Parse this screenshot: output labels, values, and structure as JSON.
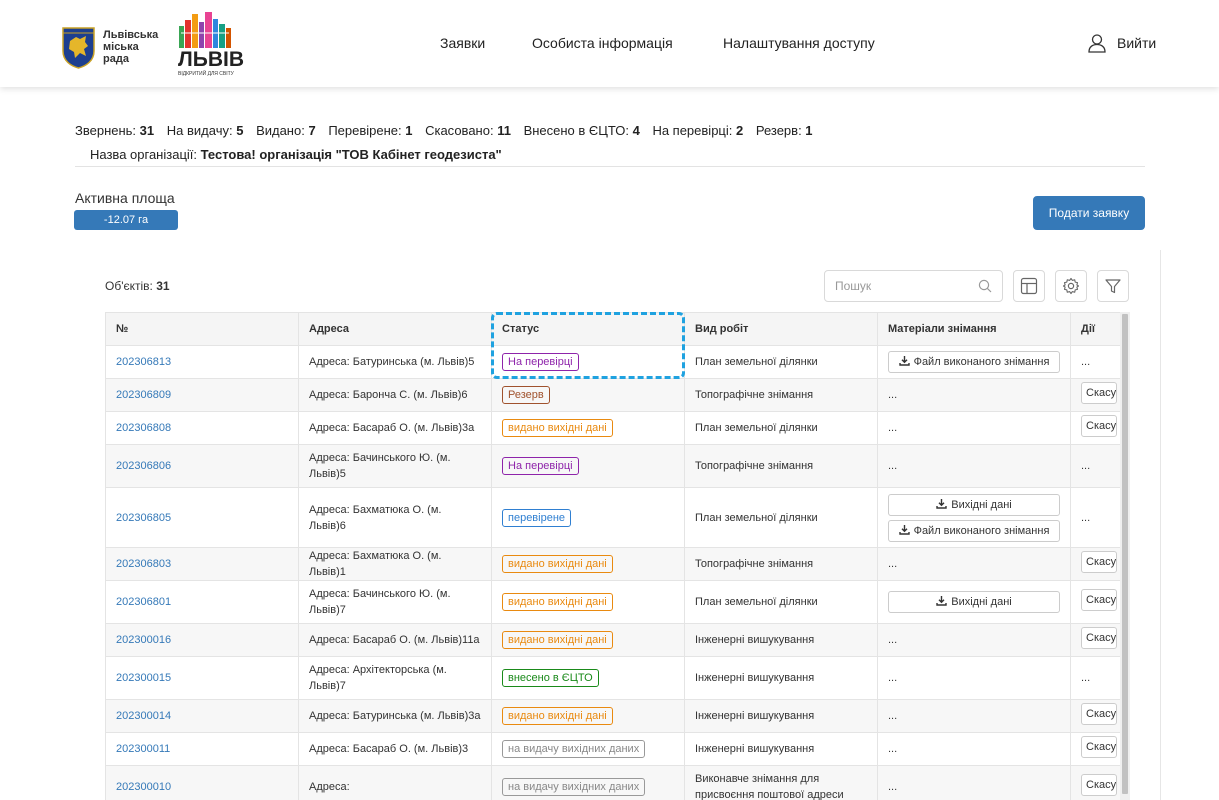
{
  "header": {
    "city_line1": "Львівська",
    "city_line2": "міська",
    "city_line3": "рада",
    "logo_word": "ЛЬВІВ",
    "logo_sub": "ВІДКРИТИЙ ДЛЯ СВІТУ",
    "nav": [
      {
        "label": "Заявки"
      },
      {
        "label": "Особиста інформація"
      },
      {
        "label": "Налаштування доступу"
      }
    ],
    "logout": "Вийти"
  },
  "stats": [
    {
      "label": "Звернень: ",
      "value": "31"
    },
    {
      "label": "На видачу: ",
      "value": "5"
    },
    {
      "label": "Видано: ",
      "value": "7"
    },
    {
      "label": "Перевірене: ",
      "value": "1"
    },
    {
      "label": "Скасовано: ",
      "value": "11"
    },
    {
      "label": "Внесено в ЄЦТО: ",
      "value": "4"
    },
    {
      "label": "На перевірці: ",
      "value": "2"
    },
    {
      "label": "Резерв: ",
      "value": "1"
    }
  ],
  "org": {
    "label": "Назва організації: ",
    "value": "Тестова! організація \"ТОВ Кабінет геодезиста\""
  },
  "area": {
    "label": "Активна площа",
    "value": "-12.07 га"
  },
  "submit_label": "Подати заявку",
  "objects": {
    "label": "Об'єктів: ",
    "value": "31"
  },
  "search": {
    "placeholder": "Пошук"
  },
  "table": {
    "headers": [
      "№",
      "Адреса",
      "Статус",
      "Вид робіт",
      "Матеріали знімання",
      "Дії"
    ],
    "rows": [
      {
        "id": "202306813",
        "address": "Адреса: Батуринська (м. Львів)5",
        "status": "На перевірці",
        "work": "План земельної ділянки",
        "materials": [
          "Файл виконаного знімання"
        ],
        "action": "..."
      },
      {
        "id": "202306809",
        "address": "Адреса: Барончa С. (м. Львів)6",
        "status": "Резерв",
        "work": "Топографічне знімання",
        "materials_text": "...",
        "action": "Скасувати"
      },
      {
        "id": "202306808",
        "address": "Адреса: Басараб О. (м. Львів)3а",
        "status": "видано вихідні дані",
        "work": "План земельної ділянки",
        "materials_text": "...",
        "action": "Скасувати"
      },
      {
        "id": "202306806",
        "address": "Адреса: Бачинського Ю. (м. Львів)5",
        "status": "На перевірці",
        "work": "Топографічне знімання",
        "materials_text": "...",
        "action": "..."
      },
      {
        "id": "202306805",
        "address": "Адреса: Бахматюка О. (м. Львів)6",
        "status": "перевірене",
        "work": "План земельної ділянки",
        "materials": [
          "Вихідні дані",
          "Файл виконаного знімання"
        ],
        "action": "..."
      },
      {
        "id": "202306803",
        "address": "Адреса: Бахматюка О. (м. Львів)1",
        "status": "видано вихідні дані",
        "work": "Топографічне знімання",
        "materials_text": "...",
        "action": "Скасувати"
      },
      {
        "id": "202306801",
        "address": "Адреса: Бачинського Ю. (м. Львів)7",
        "status": "видано вихідні дані",
        "work": "План земельної ділянки",
        "materials": [
          "Вихідні дані"
        ],
        "action": "Скасувати"
      },
      {
        "id": "202300016",
        "address": "Адреса: Басараб О. (м. Львів)11а",
        "status": "видано вихідні дані",
        "work": "Інженерні вишукування",
        "materials_text": "...",
        "action": "Скасувати"
      },
      {
        "id": "202300015",
        "address": "Адреса: Архітекторська (м. Львів)7",
        "status": "внесено в ЄЦТО",
        "work": "Інженерні вишукування",
        "materials_text": "...",
        "action": "..."
      },
      {
        "id": "202300014",
        "address": "Адреса: Батуринська (м. Львів)3а",
        "status": "видано вихідні дані",
        "work": "Інженерні вишукування",
        "materials_text": "...",
        "action": "Скасувати"
      },
      {
        "id": "202300011",
        "address": "Адреса: Басараб О. (м. Львів)3",
        "status": "на видачу вихідних даних",
        "work": "Інженерні вишукування",
        "materials_text": "...",
        "action": "Скасувати"
      },
      {
        "id": "202300010",
        "address": "Адреса:",
        "status": "на видачу вихідних даних",
        "work": "Виконавче знімання для присвоєння поштової адреси",
        "materials_text": "...",
        "action": "Скасувати"
      }
    ]
  },
  "colors": {
    "primary": "#3579b8",
    "link": "#3579b8",
    "status_review": "#8e24aa",
    "status_reserve": "#a0522d",
    "status_issued": "#e98a10",
    "status_checked": "#2f7fd1",
    "status_ecto": "#1a8a1a",
    "status_pending": "#888888",
    "highlight": "#1fa2e0"
  }
}
